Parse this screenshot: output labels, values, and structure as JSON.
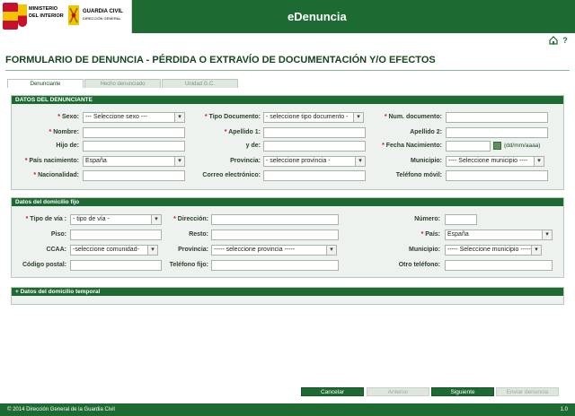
{
  "header": {
    "ministry_line1": "MINISTERIO",
    "ministry_line2": "DEL INTERIOR",
    "agency": "GUARDIA CIVIL",
    "agency_sub": "DIRECCIÓN GENERAL",
    "app_title": "eDenuncia"
  },
  "icons": {
    "home": "home-icon",
    "help": "help-icon"
  },
  "page_title": "FORMULARIO DE DENUNCIA - PÉRDIDA O EXTRAVÍO DE DOCUMENTACIÓN Y/O EFECTOS",
  "tabs": [
    {
      "label": "Denunciante"
    },
    {
      "label": "Hecho denunciado"
    },
    {
      "label": "Unidad G.C."
    }
  ],
  "denunciante": {
    "section_title": "DATOS DEL DENUNCIANTE",
    "sexo": {
      "label": "Sexo:",
      "value": "--- Seleccione sexo ---"
    },
    "tipo_documento": {
      "label": "Tipo Documento:",
      "value": "- seleccione tipo documento -"
    },
    "num_documento": {
      "label": "Num. documento:",
      "value": ""
    },
    "nombre": {
      "label": "Nombre:",
      "value": ""
    },
    "apellido1": {
      "label": "Apellido 1:",
      "value": ""
    },
    "apellido2": {
      "label": "Apellido 2:",
      "value": ""
    },
    "hijo_de": {
      "label": "Hijo de:",
      "value": ""
    },
    "y_de": {
      "label": "y de:",
      "value": ""
    },
    "fecha_nacimiento": {
      "label": "Fecha Nacimiento:",
      "value": "",
      "hint": "(dd/mm/aaaa)"
    },
    "pais_nacimiento": {
      "label": "País nacimiento:",
      "value": "España"
    },
    "provincia": {
      "label": "Provincia:",
      "value": "- seleccione provincia -"
    },
    "municipio": {
      "label": "Municipio:",
      "value": "---- Seleccione municipio ----"
    },
    "nacionalidad": {
      "label": "Nacionalidad:",
      "value": ""
    },
    "correo": {
      "label": "Correo electrónico:",
      "value": ""
    },
    "telefono_movil": {
      "label": "Teléfono móvil:",
      "value": ""
    }
  },
  "domicilio": {
    "section_title": "Datos del domicilio fijo",
    "tipo_via": {
      "label": "Tipo de vía :",
      "value": "- tipo de vía -"
    },
    "direccion": {
      "label": "Dirección:",
      "value": ""
    },
    "numero": {
      "label": "Número:",
      "value": ""
    },
    "piso": {
      "label": "Piso:",
      "value": ""
    },
    "resto": {
      "label": "Resto:",
      "value": ""
    },
    "pais": {
      "label": "País:",
      "value": "España"
    },
    "ccaa": {
      "label": "CCAA:",
      "value": "-seleccione comunidad-"
    },
    "provincia": {
      "label": "Provincia:",
      "value": "----- seleccione provincia -----"
    },
    "municipio": {
      "label": "Municipio:",
      "value": "----- Seleccione municipio -----"
    },
    "codigo_postal": {
      "label": "Código postal:",
      "value": ""
    },
    "telefono_fijo": {
      "label": "Teléfono fijo:",
      "value": ""
    },
    "otro_telefono": {
      "label": "Otro teléfono:",
      "value": ""
    }
  },
  "domicilio_temporal": {
    "section_title": "+ Datos del domicilio temporal"
  },
  "buttons": {
    "cancelar": "Cancelar",
    "anterior": "Anterior",
    "siguiente": "Siguiente",
    "enviar": "Enviar denuncia"
  },
  "footer": {
    "copyright": "© 2014 Dirección General de la Guardia Civil",
    "version": "1.0"
  },
  "colors": {
    "brand_green": "#1d6b32",
    "required_red": "#c8102e",
    "panel_bg": "#eef2ee"
  }
}
